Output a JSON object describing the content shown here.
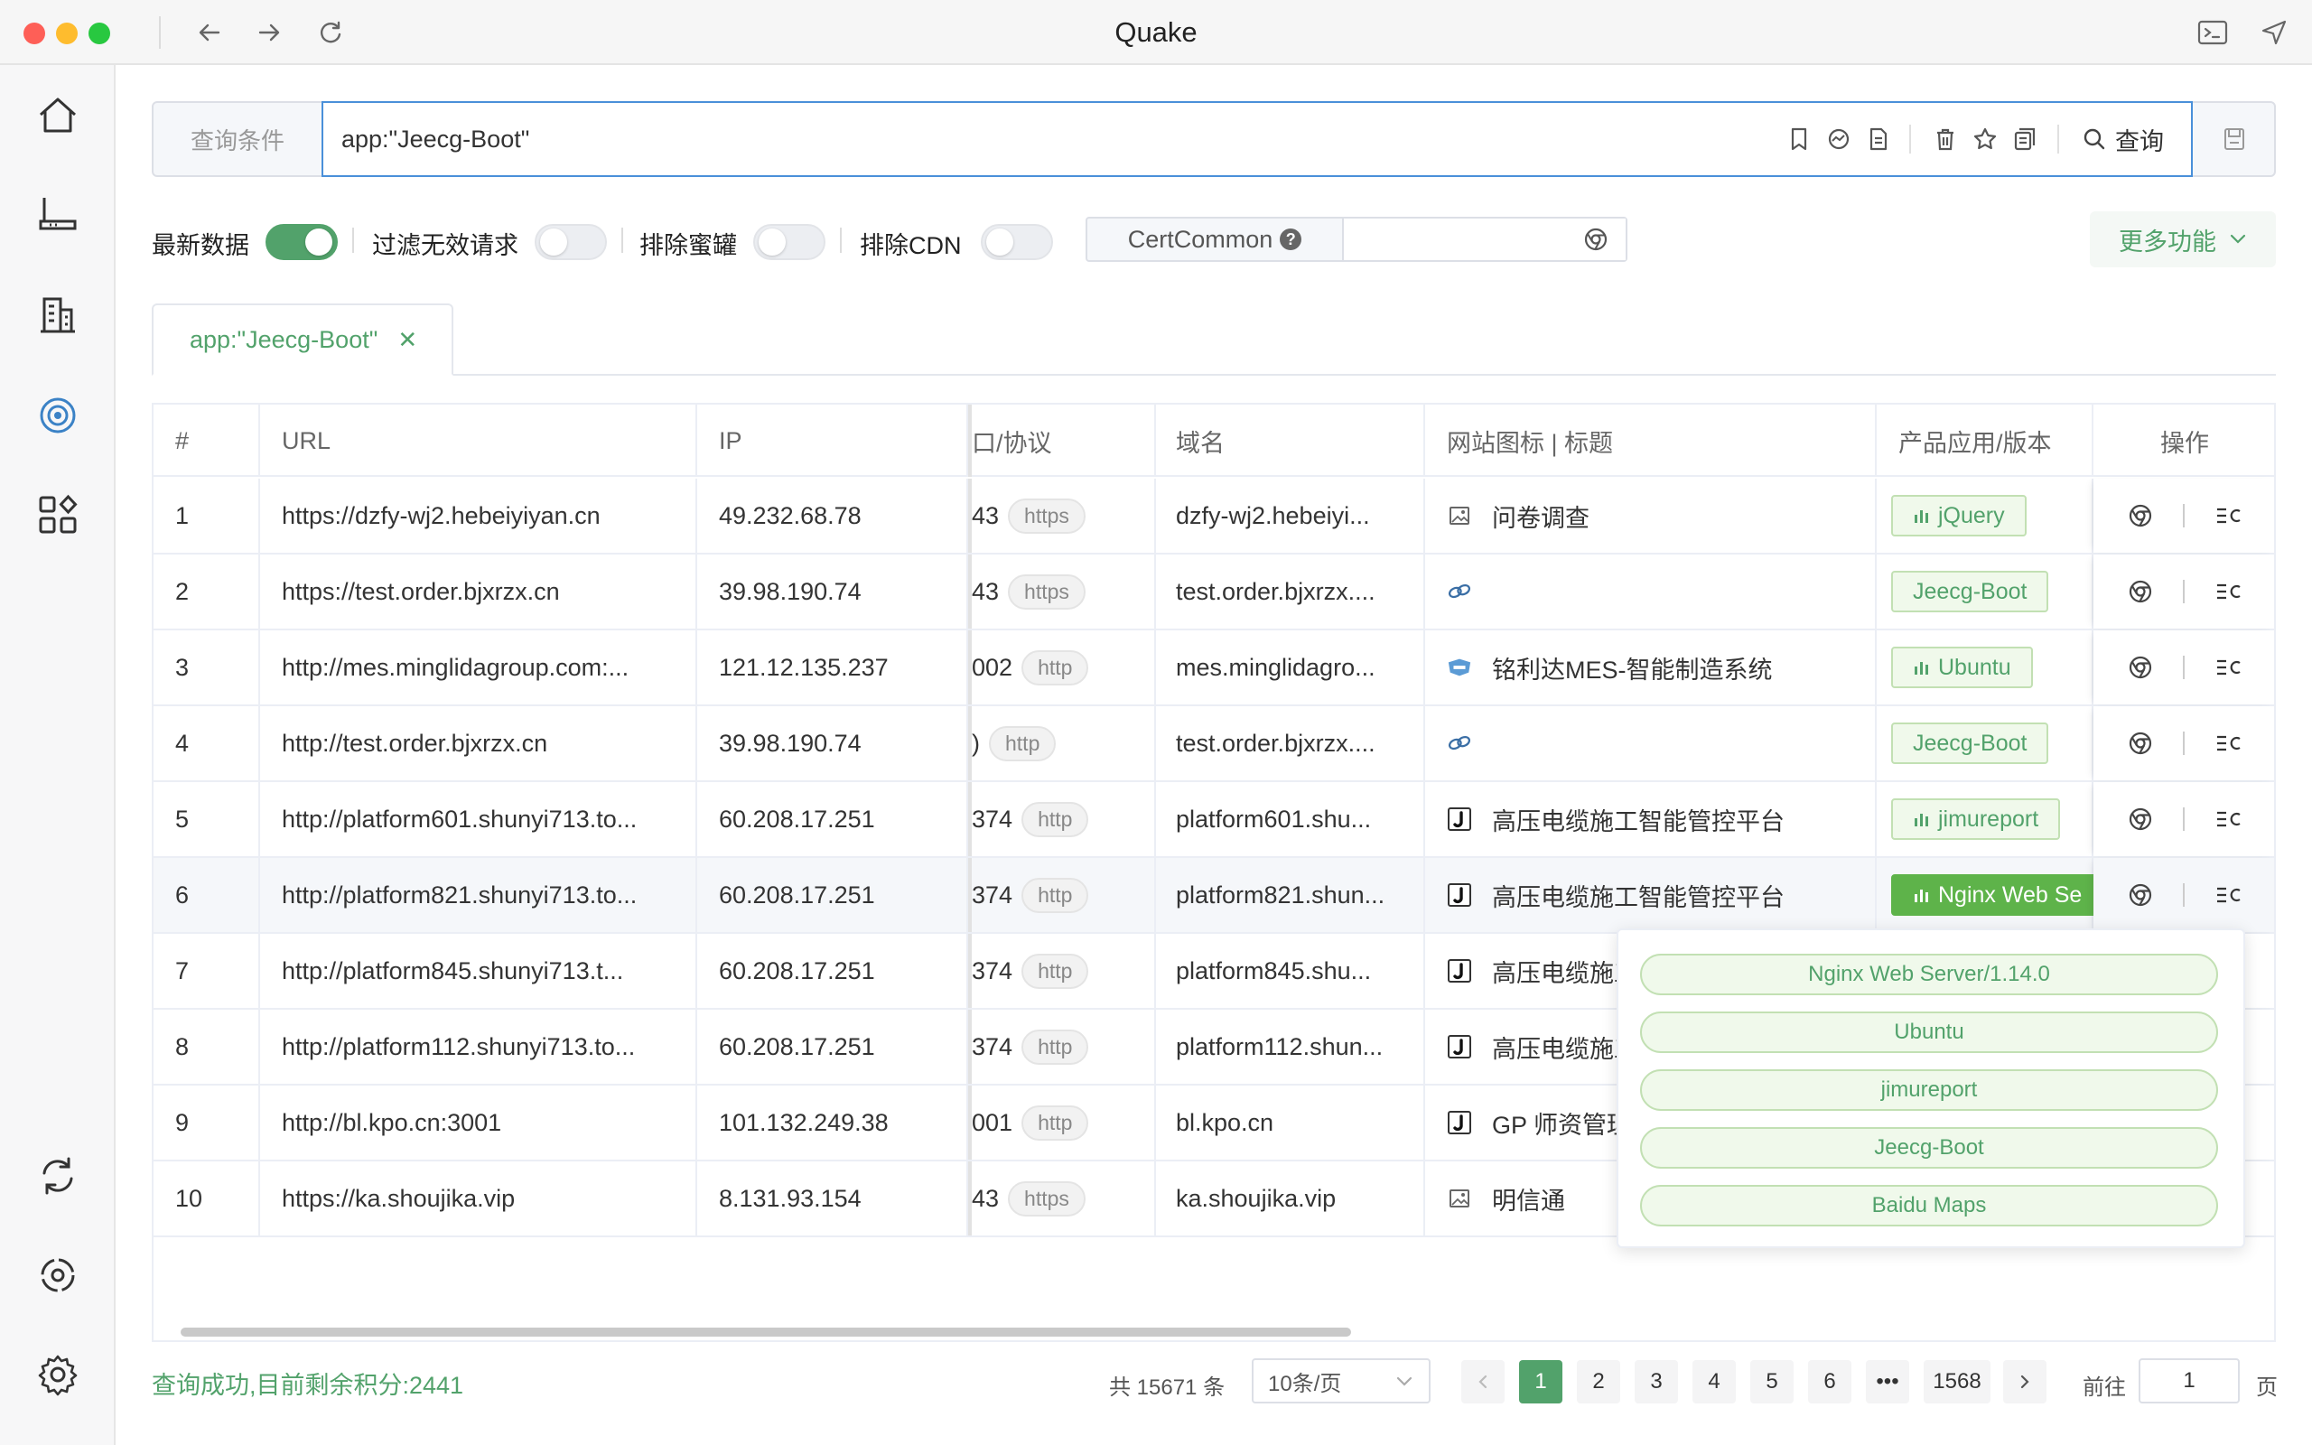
{
  "window": {
    "title": "Quake"
  },
  "search": {
    "label": "查询条件",
    "value": "app:\"Jeecg-Boot\"",
    "query_label": "查询"
  },
  "filters": {
    "latest_label": "最新数据",
    "latest_on": true,
    "invalid_label": "过滤无效请求",
    "invalid_on": false,
    "honeypot_label": "排除蜜罐",
    "honeypot_on": false,
    "cdn_label": "排除CDN",
    "cdn_on": false,
    "cert_label": "CertCommon",
    "more_label": "更多功能"
  },
  "tab": {
    "label": "app:\"Jeecg-Boot\""
  },
  "table": {
    "headers": [
      "#",
      "URL",
      "IP",
      "口/协议",
      "域名",
      "网站图标 | 标题",
      "产品应用/版本",
      "操作"
    ],
    "rows": [
      {
        "num": "1",
        "url": "https://dzfy-wj2.hebeiyiyan.cn",
        "ip": "49.232.68.78",
        "port": "43",
        "proto": "https",
        "domain": "dzfy-wj2.hebeiyi...",
        "icon": "image-icon",
        "title": "问卷调查",
        "product": "jQuery",
        "bars": true
      },
      {
        "num": "2",
        "url": "https://test.order.bjxrzx.cn",
        "ip": "39.98.190.74",
        "port": "43",
        "proto": "https",
        "domain": "test.order.bjxrzx....",
        "icon": "link-icon",
        "title": "",
        "product": "Jeecg-Boot",
        "bars": false
      },
      {
        "num": "3",
        "url": "http://mes.minglidagroup.com:...",
        "ip": "121.12.135.237",
        "port": "002",
        "proto": "http",
        "domain": "mes.minglidagro...",
        "icon": "mes-logo-icon",
        "title": "铭利达MES-智能制造系统",
        "product": "Ubuntu",
        "bars": true
      },
      {
        "num": "4",
        "url": "http://test.order.bjxrzx.cn",
        "ip": "39.98.190.74",
        "port": ")",
        "proto": "http",
        "domain": "test.order.bjxrzx....",
        "icon": "link-icon",
        "title": "",
        "product": "Jeecg-Boot",
        "bars": false
      },
      {
        "num": "5",
        "url": "http://platform601.shunyi713.to...",
        "ip": "60.208.17.251",
        "port": "374",
        "proto": "http",
        "domain": "platform601.shu...",
        "icon": "j-logo-icon",
        "title": "高压电缆施工智能管控平台",
        "product": "jimureport",
        "bars": true
      },
      {
        "num": "6",
        "url": "http://platform821.shunyi713.to...",
        "ip": "60.208.17.251",
        "port": "374",
        "proto": "http",
        "domain": "platform821.shun...",
        "icon": "j-logo-icon",
        "title": "高压电缆施工智能管控平台",
        "product": "Nginx Web Se",
        "bars": true
      },
      {
        "num": "7",
        "url": "http://platform845.shunyi713.t...",
        "ip": "60.208.17.251",
        "port": "374",
        "proto": "http",
        "domain": "platform845.shu...",
        "icon": "j-logo-icon",
        "title": "高压电缆施工智能管控平台",
        "product": "",
        "bars": false
      },
      {
        "num": "8",
        "url": "http://platform112.shunyi713.to...",
        "ip": "60.208.17.251",
        "port": "374",
        "proto": "http",
        "domain": "platform112.shun...",
        "icon": "j-logo-icon",
        "title": "高压电缆施工智能管控平台",
        "product": "",
        "bars": false
      },
      {
        "num": "9",
        "url": "http://bl.kpo.cn:3001",
        "ip": "101.132.249.38",
        "port": "001",
        "proto": "http",
        "domain": "bl.kpo.cn",
        "icon": "j-logo-icon",
        "title": "GP 师资管理",
        "product": "",
        "bars": false
      },
      {
        "num": "10",
        "url": "https://ka.shoujika.vip",
        "ip": "8.131.93.154",
        "port": "43",
        "proto": "https",
        "domain": "ka.shoujika.vip",
        "icon": "image-icon",
        "title": "明信通",
        "product": "",
        "bars": false
      }
    ]
  },
  "popover": {
    "items": [
      "Nginx Web Server/1.14.0",
      "Ubuntu",
      "jimureport",
      "Jeecg-Boot",
      "Baidu Maps"
    ]
  },
  "footer": {
    "status": "查询成功,目前剩余积分:2441",
    "total": "共 15671 条",
    "page_size": "10条/页",
    "pages": [
      "1",
      "2",
      "3",
      "4",
      "5",
      "6",
      "•••",
      "1568"
    ],
    "goto_label": "前往",
    "goto_value": "1",
    "page_suffix": "页"
  },
  "colors": {
    "accent": "#52a26b",
    "tag_bg": "#f0f9eb",
    "tag_border": "#c2e0b3",
    "input_focus": "#4a90d9"
  }
}
